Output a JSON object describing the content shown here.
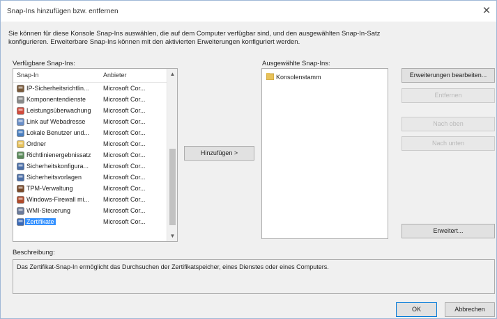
{
  "window": {
    "title": "Snap-Ins hinzufügen bzw. entfernen",
    "close_glyph": "✕"
  },
  "intro": {
    "line1": "Sie können für diese Konsole Snap-Ins auswählen, die auf dem Computer verfügbar sind, und den ausgewählten Snap-In-Satz",
    "line2": "konfigurieren. Erweiterbare Snap-Ins können mit den aktivierten Erweiterungen konfiguriert werden."
  },
  "available": {
    "label": "Verfügbare Snap-Ins:",
    "col_snapin": "Snap-In",
    "col_vendor": "Anbieter",
    "items": [
      {
        "name": "IP-Sicherheitsrichtlin...",
        "vendor": "Microsoft Cor...",
        "icon": "security-policy-icon",
        "color": "#7a5a3a"
      },
      {
        "name": "Komponentendienste",
        "vendor": "Microsoft Cor...",
        "icon": "component-services-icon",
        "color": "#8a8a8a"
      },
      {
        "name": "Leistungsüberwachung",
        "vendor": "Microsoft Cor...",
        "icon": "performance-monitor-icon",
        "color": "#d24a3c"
      },
      {
        "name": "Link auf Webadresse",
        "vendor": "Microsoft Cor...",
        "icon": "web-link-icon",
        "color": "#6a8fc8"
      },
      {
        "name": "Lokale Benutzer und...",
        "vendor": "Microsoft Cor...",
        "icon": "local-users-icon",
        "color": "#4a7fc0"
      },
      {
        "name": "Ordner",
        "vendor": "Microsoft Cor...",
        "icon": "folder-icon",
        "color": "#e8c25a"
      },
      {
        "name": "Richtlinienergebnissatz",
        "vendor": "Microsoft Cor...",
        "icon": "policy-result-icon",
        "color": "#5a8a5a"
      },
      {
        "name": "Sicherheitskonfigura...",
        "vendor": "Microsoft Cor...",
        "icon": "security-config-icon",
        "color": "#4a6ea8"
      },
      {
        "name": "Sicherheitsvorlagen",
        "vendor": "Microsoft Cor...",
        "icon": "security-templates-icon",
        "color": "#4a6ea8"
      },
      {
        "name": "TPM-Verwaltung",
        "vendor": "Microsoft Cor...",
        "icon": "tpm-icon",
        "color": "#7a4a2a"
      },
      {
        "name": "Windows-Firewall mi...",
        "vendor": "Microsoft Cor...",
        "icon": "firewall-icon",
        "color": "#b04a2a"
      },
      {
        "name": "WMI-Steuerung",
        "vendor": "Microsoft Cor...",
        "icon": "wmi-icon",
        "color": "#6a7a9a"
      },
      {
        "name": "Zertifikate",
        "vendor": "Microsoft Cor...",
        "icon": "certificates-icon",
        "color": "#3a6ab8"
      }
    ],
    "selected_index": 12
  },
  "buttons": {
    "add": "Hinzufügen >",
    "edit_extensions": "Erweiterungen bearbeiten...",
    "remove": "Entfernen",
    "move_up": "Nach oben",
    "move_down": "Nach unten",
    "advanced": "Erweitert...",
    "ok": "OK",
    "cancel": "Abbrechen"
  },
  "selected": {
    "label": "Ausgewählte Snap-Ins:",
    "items": [
      "Konsolenstamm"
    ]
  },
  "description": {
    "label": "Beschreibung:",
    "text": "Das Zertifikat-Snap-In ermöglicht das Durchsuchen der Zertifikatspeicher, eines Dienstes oder eines Computers."
  }
}
